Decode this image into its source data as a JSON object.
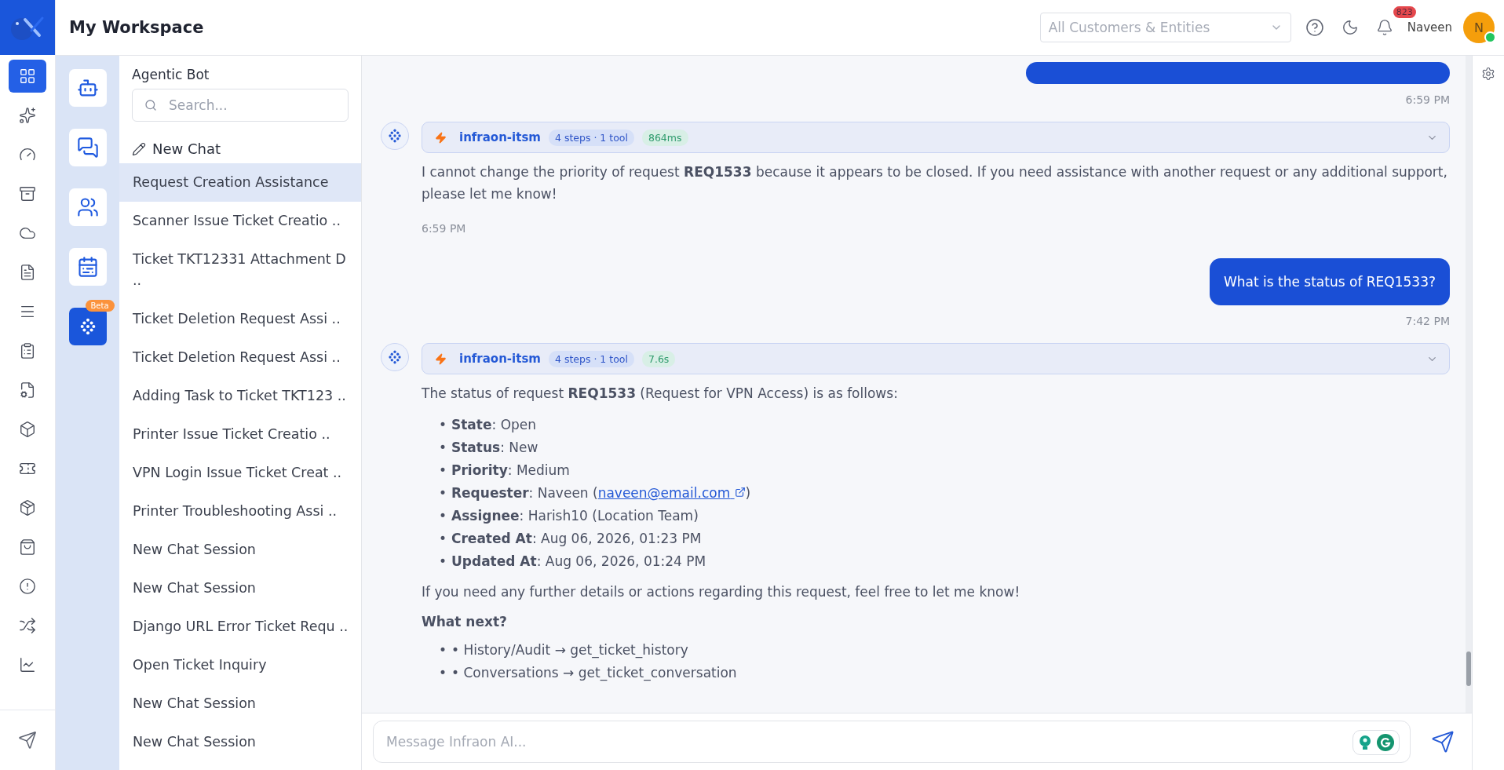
{
  "header": {
    "title": "My Workspace",
    "customer_select": {
      "placeholder": "All Customers & Entities"
    },
    "notification_count": "823",
    "user_name": "Naveen",
    "avatar_initial": "N",
    "online": true
  },
  "rail": {
    "items": [
      {
        "selected": true
      },
      {
        "selected": false
      },
      {
        "selected": false
      },
      {
        "selected": false
      },
      {
        "selected": false
      },
      {
        "selected": false
      },
      {
        "selected": false
      },
      {
        "selected": false
      },
      {
        "selected": false
      },
      {
        "selected": false
      },
      {
        "selected": false
      },
      {
        "selected": false
      },
      {
        "selected": false
      },
      {
        "selected": false
      },
      {
        "selected": false
      },
      {
        "selected": false
      }
    ]
  },
  "apps": [
    {
      "selected": false
    },
    {
      "selected": false
    },
    {
      "selected": false
    },
    {
      "selected": false
    },
    {
      "selected": true,
      "badge": "Beta"
    }
  ],
  "chat_list": {
    "title": "Agentic Bot",
    "search": {
      "placeholder": "Search..."
    },
    "new_chat": "New Chat",
    "items": [
      {
        "label": "Request Creation Assistance",
        "selected": true
      },
      {
        "label": "Scanner Issue Ticket Creatio ..",
        "selected": false
      },
      {
        "label": "Ticket TKT12331 Attachment D ..",
        "selected": false
      },
      {
        "label": "Ticket Deletion Request Assi ..",
        "selected": false
      },
      {
        "label": "Ticket Deletion Request Assi ..",
        "selected": false
      },
      {
        "label": "Adding Task to Ticket TKT123 ..",
        "selected": false
      },
      {
        "label": "Printer Issue Ticket Creatio ..",
        "selected": false
      },
      {
        "label": "VPN Login Issue Ticket Creat ..",
        "selected": false
      },
      {
        "label": "Printer Troubleshooting Assi ..",
        "selected": false
      },
      {
        "label": "New Chat Session",
        "selected": false
      },
      {
        "label": "New Chat Session",
        "selected": false
      },
      {
        "label": "Django URL Error Ticket Requ ..",
        "selected": false
      },
      {
        "label": "Open Ticket Inquiry",
        "selected": false
      },
      {
        "label": "New Chat Session",
        "selected": false
      },
      {
        "label": "New Chat Session",
        "selected": false
      }
    ]
  },
  "messages": [
    {
      "kind": "user",
      "time": "6:59 PM"
    },
    {
      "kind": "bot",
      "agent": "infraon-itsm",
      "steps": "4 steps · 1 tool",
      "duration": "864ms",
      "time": "6:59 PM",
      "blocks": [
        {
          "kind": "paragraph",
          "text": "I cannot change the priority of request **REQ1533** because it appears to be closed. If you need assistance with another request or any additional support, please let me know!"
        }
      ]
    },
    {
      "kind": "user",
      "text": "What is the status of REQ1533?",
      "time": "7:42 PM"
    },
    {
      "kind": "bot",
      "agent": "infraon-itsm",
      "steps": "4 steps · 1 tool",
      "duration": "7.6s",
      "blocks": [
        {
          "kind": "paragraph",
          "text": "The status of request **REQ1533** (Request for VPN Access) is as follows:"
        },
        {
          "kind": "fields",
          "items": [
            {
              "marker": "•",
              "text": "**State**: Open"
            },
            {
              "marker": "•",
              "text": "**Status**: New"
            },
            {
              "marker": "•",
              "text": "**Priority**: Medium"
            },
            {
              "marker": "•",
              "text": "**Requester**: Naveen (",
              "link": "naveen@email.com",
              "suffix": ")"
            },
            {
              "marker": "•",
              "text": "**Assignee**: Harish10 (Location Team)"
            },
            {
              "marker": "•",
              "text": "**Created At**: Aug 06, 2026, 01:23 PM"
            },
            {
              "marker": "•",
              "text": "**Updated At**: Aug 06, 2026, 01:24 PM"
            }
          ]
        },
        {
          "kind": "paragraph",
          "text": "If you need any further details or actions regarding this request, feel free to let me know!"
        },
        {
          "kind": "heading",
          "text": "What next?"
        },
        {
          "kind": "bullets",
          "items": [
            {
              "marker": "•",
              "text": "• History/Audit → get_ticket_history"
            },
            {
              "marker": "•",
              "text": "• Conversations → get_ticket_conversation"
            }
          ]
        }
      ]
    }
  ],
  "composer": {
    "placeholder": "Message Infraon AI..."
  }
}
